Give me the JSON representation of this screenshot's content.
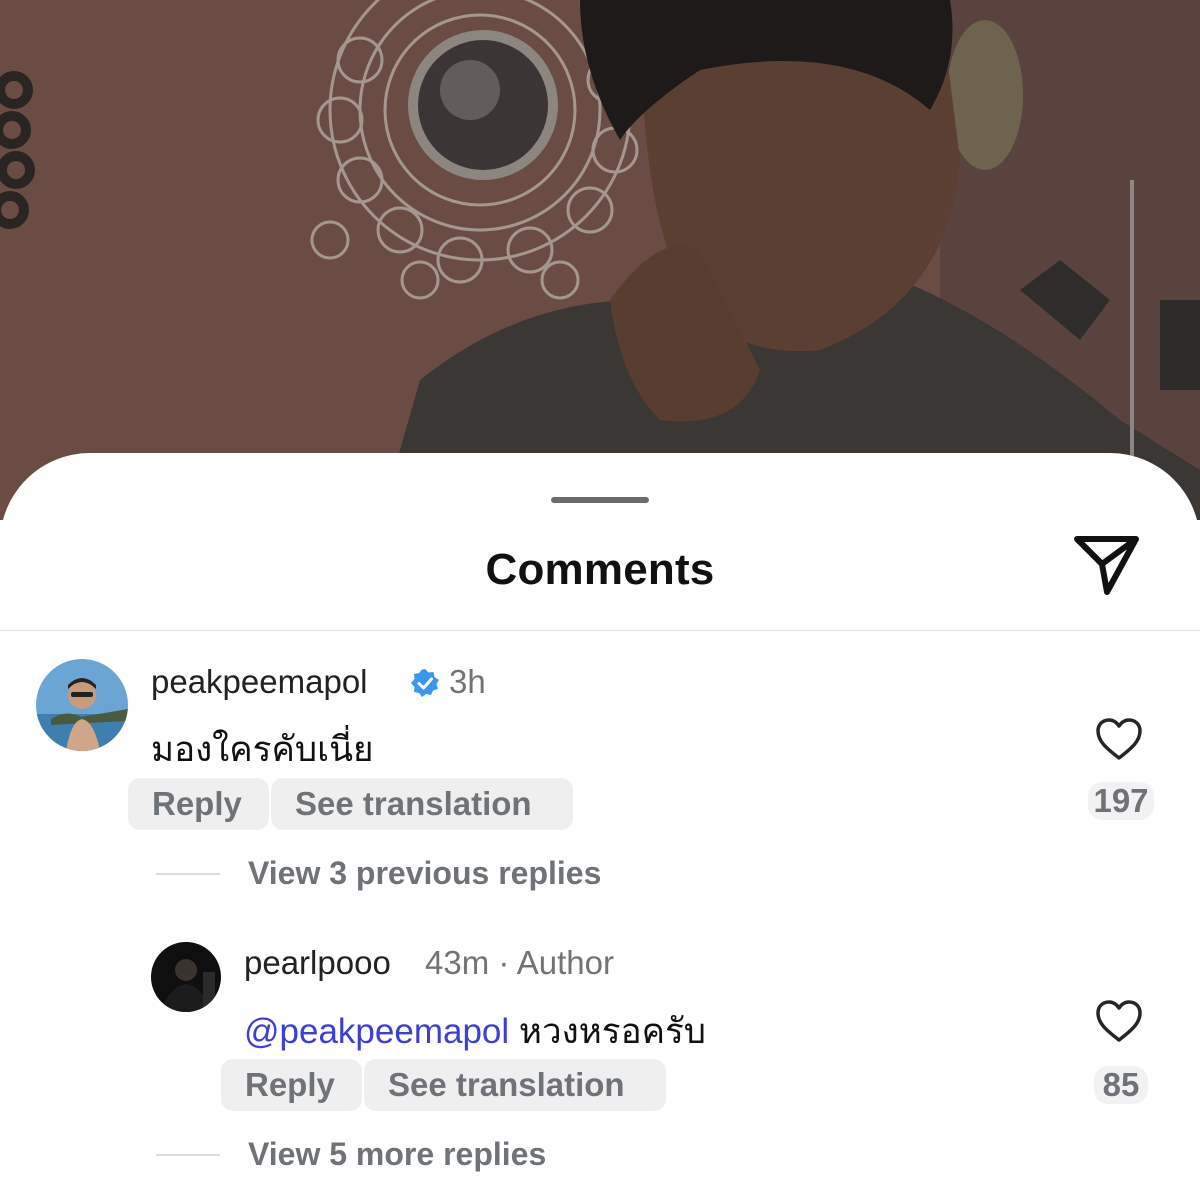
{
  "sheet": {
    "title": "Comments",
    "share_icon": "paper-plane-icon"
  },
  "comments": [
    {
      "username": "peakpeemapol",
      "verified": true,
      "time": "3h",
      "text": "มองใครคับเนี่ย",
      "reply_label": "Reply",
      "translate_label": "See translation",
      "likes": "197",
      "view_replies": "View 3 previous replies"
    },
    {
      "username": "pearlpooo",
      "time": "43m",
      "separator": "·",
      "badge": "Author",
      "mention": "@peakpeemapol",
      "text": "หวงหรอครับ",
      "reply_label": "Reply",
      "translate_label": "See translation",
      "likes": "85",
      "view_replies": "View 5 more replies"
    }
  ],
  "colors": {
    "accent_blue": "#3b3fd6",
    "verified_blue": "#3897f0",
    "muted_text": "#737373"
  }
}
